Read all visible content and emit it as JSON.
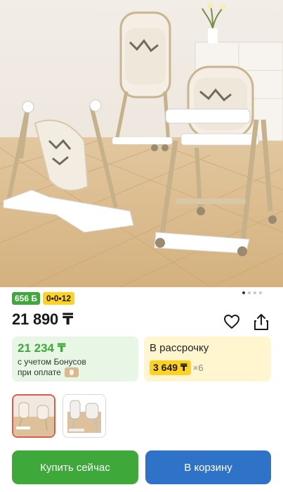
{
  "product": {
    "bonus_badge": "656 Б",
    "installment_badge": "0•0•12",
    "price": "21 890 ₸"
  },
  "gallery": {
    "total_slides": 4,
    "active_slide": 1
  },
  "bonus_card": {
    "price": "21 234 ₸",
    "note_line1": "с учетом Бонусов",
    "note_line2": "при оплате"
  },
  "installment_card": {
    "title": "В рассрочку",
    "monthly": "3 649 ₸",
    "times": "×6"
  },
  "actions": {
    "buy_now": "Купить сейчас",
    "add_to_cart": "В корзину"
  },
  "colors": {
    "green": "#3ea83a",
    "blue": "#2f73c9",
    "yellow": "#ffd21f",
    "selected_thumb_border": "#e05a4a"
  }
}
